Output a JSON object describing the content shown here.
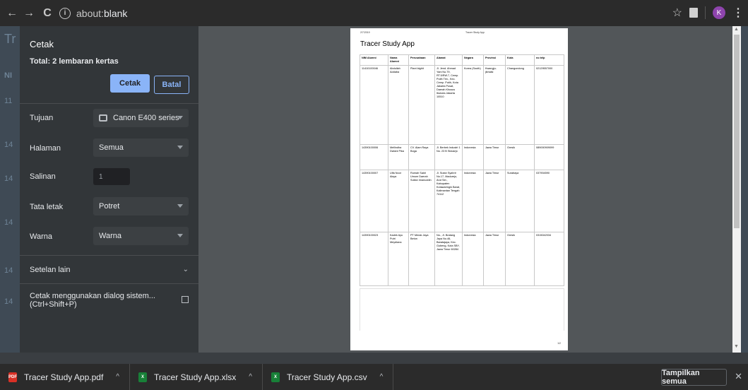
{
  "browser": {
    "back_icon": "arrow-left",
    "forward_icon": "arrow-right",
    "reload_icon": "reload",
    "address_scheme": "about:",
    "address_path": "blank",
    "avatar_letter": "K"
  },
  "background_page": {
    "heading_fragment": "Tr",
    "col_fragment": "NI",
    "rows": [
      "11",
      "14",
      "14",
      "14",
      "14",
      "14"
    ]
  },
  "print_dialog": {
    "title": "Cetak",
    "total": "Total: 2 lembaran kertas",
    "print_button": "Cetak",
    "cancel_button": "Batal",
    "destination_label": "Tujuan",
    "destination_value": "Canon E400 series",
    "pages_label": "Halaman",
    "pages_value": "Semua",
    "copies_label": "Salinan",
    "copies_value": "1",
    "layout_label": "Tata letak",
    "layout_value": "Potret",
    "color_label": "Warna",
    "color_value": "Warna",
    "more_settings": "Setelan lain",
    "system_dialog_line1": "Cetak menggunakan dialog sistem...",
    "system_dialog_line2": "(Ctrl+Shift+P)"
  },
  "preview": {
    "date": "2/7/2019",
    "header_center": "Tracer Study App",
    "title": "Tracer Study App",
    "page_number": "1/2",
    "columns": [
      "NIM Alumni",
      "Nama Alumni",
      "Perusahaan",
      "Alamat",
      "Negara",
      "Provinsi",
      "Kota",
      "no telp"
    ],
    "rows": [
      [
        "11410100046",
        "Abdullah Addaba",
        "Plant bighit",
        "Jl. Jend. Ahmad Yani No.79, RT.5/RW.7, Cemp. Putih Tim., Kec. Cemp. Putih, Kota Jakarta Pusat, Daerah Khusus Ibukota Jakarta 10510",
        "Korea (South)",
        "Kwangju-jikhalsi",
        "Changundong",
        "02129557000"
      ],
      [
        "14390100006",
        "Mellindha Dwiani Pika",
        "CV. Alam Raya Boga",
        "Jl. Berbek Industri 1 No. 23 B Sidoarjo",
        "Indonesia",
        "Jawa Timur",
        "Gresik",
        "089000909099"
      ],
      [
        "14390100007",
        "Ulfa Noor Aisya",
        "Rumah Sakit Umum Daerah Sultan Imanuddin",
        "Jl. Sutan Syahrir No.17, Madurejo, Arut Sel., Kabupaten Kotawaringin Barat, Kalimantan Tengah 74112",
        "Indonesia",
        "Jawa Timur",
        "Surabaya",
        "037904590"
      ],
      [
        "14390100023",
        "Kadek Ayu Putri Meydiana",
        "PT Merak Jaya Beton",
        "No., Jl. Bratang Jaya No.46, Baratajaya, Kec. Gubeng, Kota SBY, Jawa Timur 60284",
        "Indonesia",
        "Jawa Timur",
        "Gresik",
        "0315042034"
      ]
    ]
  },
  "downloads": {
    "items": [
      {
        "name": "Tracer Study App.pdf",
        "type": "PDF",
        "color": "#d93025"
      },
      {
        "name": "Tracer Study App.xlsx",
        "type": "X",
        "color": "#188038"
      },
      {
        "name": "Tracer Study App.csv",
        "type": "X",
        "color": "#188038"
      }
    ],
    "show_all": "Tampilkan semua"
  },
  "colors": {
    "accent": "#8ab4f8",
    "sidebar_bg": "#323639",
    "preview_bg": "#525659"
  }
}
